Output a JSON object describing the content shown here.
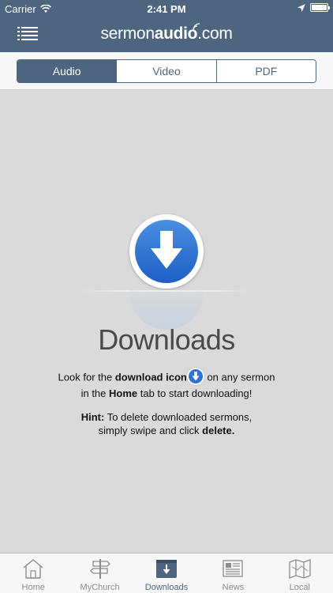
{
  "status_bar": {
    "carrier": "Carrier",
    "time": "2:41 PM"
  },
  "header": {
    "logo_part1": "sermon",
    "logo_part2": "audio",
    "logo_part3": ".com"
  },
  "segments": {
    "items": [
      {
        "label": "Audio",
        "active": true
      },
      {
        "label": "Video",
        "active": false
      },
      {
        "label": "PDF",
        "active": false
      }
    ]
  },
  "empty_state": {
    "title": "Downloads",
    "line1_a": "Look for the ",
    "line1_b": "download icon",
    "line1_c": " on any sermon",
    "line2_a": "in the ",
    "line2_b": "Home",
    "line2_c": " tab to start downloading!",
    "hint_label": "Hint:",
    "hint_a": " To delete downloaded sermons,",
    "hint_b": "simply swipe and click ",
    "hint_c": "delete."
  },
  "tabbar": {
    "items": [
      {
        "label": "Home",
        "icon": "home-icon"
      },
      {
        "label": "MyChurch",
        "icon": "signpost-icon"
      },
      {
        "label": "Downloads",
        "icon": "download-tray-icon"
      },
      {
        "label": "News",
        "icon": "newspaper-icon"
      },
      {
        "label": "Local",
        "icon": "map-icon"
      }
    ],
    "active_index": 2
  },
  "colors": {
    "brand": "#4e6580",
    "accent_blue": "#2f72d0",
    "background": "#dadada"
  }
}
